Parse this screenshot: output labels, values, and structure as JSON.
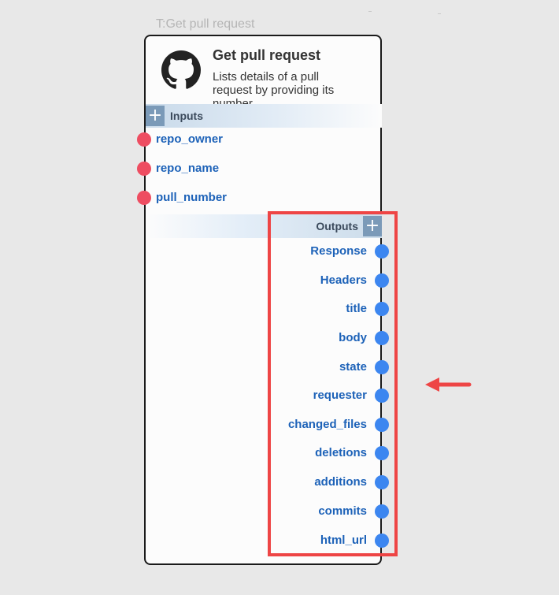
{
  "canvas": {
    "caption": "T:Get pull request"
  },
  "node": {
    "title": "Get pull request",
    "description": "Lists details of a pull request by providing its number",
    "icon": "github-logo-icon",
    "inputs_label": "Inputs",
    "outputs_label": "Outputs",
    "inputs": [
      "repo_owner",
      "repo_name",
      "pull_number"
    ],
    "outputs": [
      "Response",
      "Headers",
      "title",
      "body",
      "state",
      "requester",
      "changed_files",
      "deletions",
      "additions",
      "commits",
      "html_url"
    ]
  },
  "colors": {
    "input_port": "#ee4d61",
    "output_port": "#3c86f0",
    "port_label": "#1d62b8",
    "highlight": "#ee4545",
    "plus_button": "#7b9ab8"
  }
}
